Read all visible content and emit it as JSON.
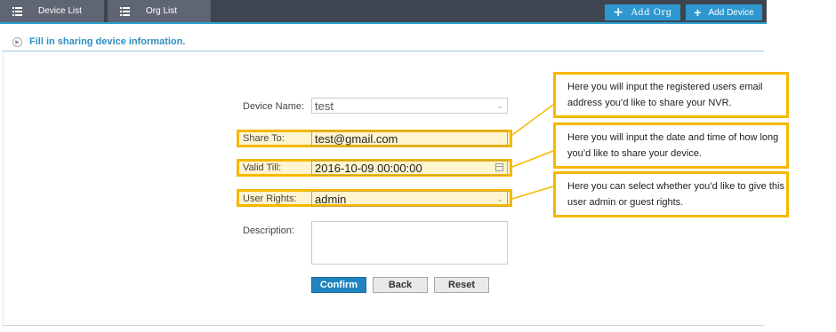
{
  "tabs": [
    {
      "label": "Device List",
      "icon": "list-icon"
    },
    {
      "label": "Org List",
      "icon": "list-icon"
    }
  ],
  "toolbar": {
    "add_org_label": "Add Org",
    "add_device_label": "Add Device"
  },
  "section": {
    "title": "Fill in sharing device information."
  },
  "form": {
    "device_name": {
      "label": "Device Name:",
      "value": "test"
    },
    "share_to": {
      "label": "Share To:",
      "value": "test@gmail.com"
    },
    "valid_till": {
      "label": "Valid Till:",
      "value": "2016-10-09 00:00:00"
    },
    "user_rights": {
      "label": "User Rights:",
      "value": "admin"
    },
    "description": {
      "label": "Description:",
      "value": ""
    }
  },
  "buttons": {
    "confirm": "Confirm",
    "back": "Back",
    "reset": "Reset"
  },
  "callouts": [
    "Here you will input the registered users email address you’d like to share your NVR.",
    "Here you will input the date and time of how long you’d like to share your device.",
    "Here you can select whether you’d like to give this user admin or guest rights."
  ],
  "colors": {
    "accent": "#2e97cf",
    "highlight": "#f5b800",
    "topbar": "#3e4450"
  }
}
